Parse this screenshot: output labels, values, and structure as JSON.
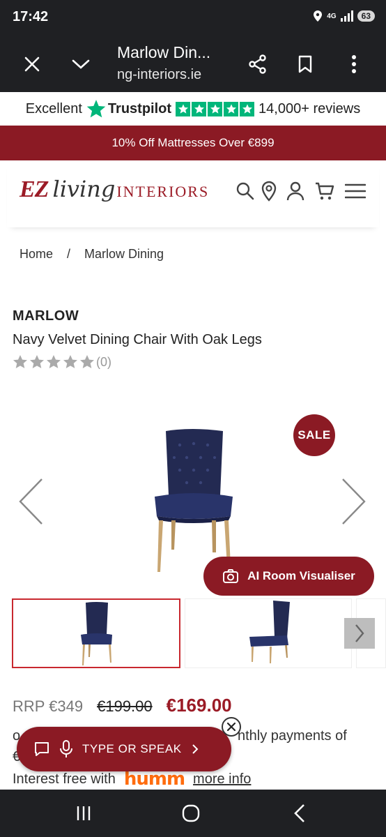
{
  "status": {
    "time": "17:42",
    "network": "4G",
    "battery": "63"
  },
  "browser": {
    "title": "Marlow Din...",
    "url": "ng-interiors.ie"
  },
  "trustpilot": {
    "rating_word": "Excellent",
    "brand": "Trustpilot",
    "reviews": "14,000+ reviews",
    "stars": 5,
    "color": "#00b67a"
  },
  "promo": {
    "text": "10% Off Mattresses Over €899"
  },
  "logo": {
    "ez": "EZ",
    "living": "living",
    "interiors": "INTERIORS"
  },
  "breadcrumb": {
    "home": "Home",
    "separator": "/",
    "current": "Marlow Dining"
  },
  "product": {
    "brand": "MARLOW",
    "title": "Navy Velvet Dining Chair With Oak Legs",
    "rating_stars": 0,
    "review_count": "(0)",
    "sale_badge": "SALE",
    "ai_button": "AI Room Visualiser",
    "rrp": "RRP €349",
    "was_price": "€199.00",
    "price": "€169.00",
    "monthly_a": "o",
    "monthly_b": "€",
    "monthly_c": "nthly payments of",
    "interest_text": "Interest free with",
    "humm": "humm",
    "more_info": "more info"
  },
  "assistant": {
    "label": "TYPE OR SPEAK"
  },
  "colors": {
    "accent": "#8b1a24",
    "bar": "#1f2023"
  }
}
